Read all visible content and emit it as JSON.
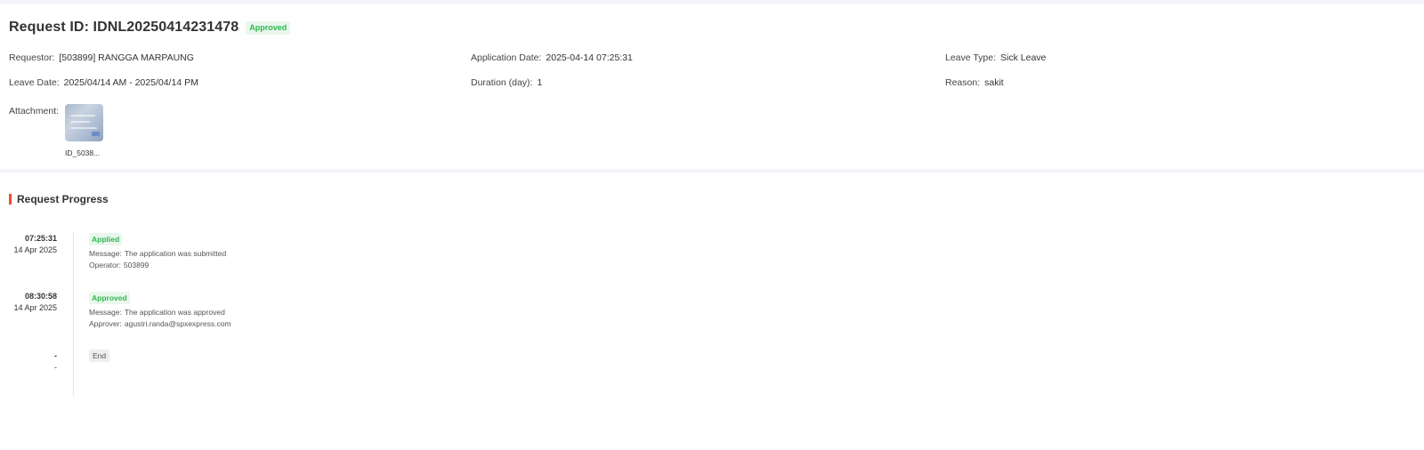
{
  "header": {
    "title": "Request ID: IDNL20250414231478",
    "status_badge": "Approved"
  },
  "details": {
    "requestor_label": "Requestor:",
    "requestor_value": "[503899] RANGGA MARPAUNG",
    "application_date_label": "Application Date:",
    "application_date_value": "2025-04-14 07:25:31",
    "leave_type_label": "Leave Type:",
    "leave_type_value": "Sick Leave",
    "leave_date_label": "Leave Date:",
    "leave_date_value": "2025/04/14 AM - 2025/04/14 PM",
    "duration_label": "Duration (day):",
    "duration_value": "1",
    "reason_label": "Reason:",
    "reason_value": "sakit",
    "attachment_label": "Attachment:",
    "attachment_name": "ID_5038..."
  },
  "progress": {
    "title": "Request Progress",
    "accent_color": "#ee4d2d",
    "steps": [
      {
        "time": "07:25:31",
        "date": "14 Apr 2025",
        "status": "Applied",
        "message_label": "Message:",
        "message_value": "The application was submitted",
        "actor_label": "Operator:",
        "actor_value": "503899"
      },
      {
        "time": "08:30:58",
        "date": "14 Apr 2025",
        "status": "Approved",
        "message_label": "Message:",
        "message_value": "The application was approved",
        "actor_label": "Approver:",
        "actor_value": "agustri.randa@spxexpress.com"
      },
      {
        "time": "-",
        "date": "-",
        "status": "End"
      }
    ]
  }
}
